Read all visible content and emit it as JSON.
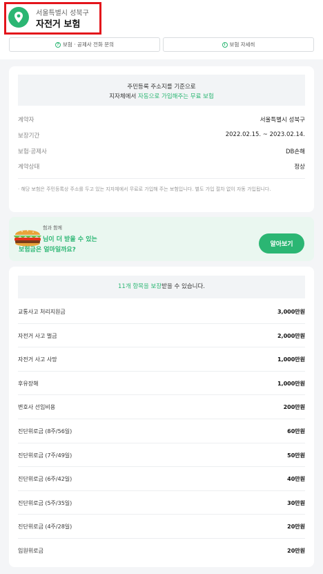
{
  "header": {
    "region": "서울특별시 성북구",
    "title": "자전거 보험",
    "phone_button": "보험 · 공제사 전화 문의",
    "detail_button": "보험 자세히"
  },
  "notice": {
    "line1": "주민등록 주소지를 기준으로",
    "line2_prefix": "지자체에서 ",
    "line2_highlight": "자동으로 가입해주는 무료 보험"
  },
  "info": [
    {
      "key": "계약자",
      "value": "서울특별시 성북구"
    },
    {
      "key": "보장기간",
      "value": "2022.02.15. ~ 2023.02.14."
    },
    {
      "key": "보험·공제사",
      "value": "DB손해"
    },
    {
      "key": "계약상태",
      "value": "정상"
    }
  ],
  "disclaimer": "· 해당 보험은 주민등록상 주소를 두고 있는 지자체에서 무료로 가입해 주는 보험입니다. 별도 가입 절차 없이 자동 가입됩니다.",
  "promo": {
    "small": "험과 함께",
    "line1_green": "님이 더 받을 수 있는",
    "line2": "보험금은 얼마일까요?",
    "cta": "알아보기"
  },
  "coverage": {
    "count": "11개 항목을 보장",
    "suffix": "받을 수 있습니다.",
    "items": [
      {
        "name": "교통사고 처리지원금",
        "amount": "3,000만원"
      },
      {
        "name": "자전거 사고 벌금",
        "amount": "2,000만원"
      },
      {
        "name": "자전거 사고 사망",
        "amount": "1,000만원"
      },
      {
        "name": "후유장해",
        "amount": "1,000만원"
      },
      {
        "name": "변호사 선임비용",
        "amount": "200만원"
      },
      {
        "name": "진단위로금 (8주/56일)",
        "amount": "60만원"
      },
      {
        "name": "진단위로금 (7주/49일)",
        "amount": "50만원"
      },
      {
        "name": "진단위로금 (6주/42일)",
        "amount": "40만원"
      },
      {
        "name": "진단위로금 (5주/35일)",
        "amount": "30만원"
      },
      {
        "name": "진단위로금 (4주/28일)",
        "amount": "20만원"
      },
      {
        "name": "입원위로금",
        "amount": "20만원"
      }
    ]
  },
  "colors": {
    "accent": "#2bb673",
    "highlight_border": "#e3141b"
  }
}
